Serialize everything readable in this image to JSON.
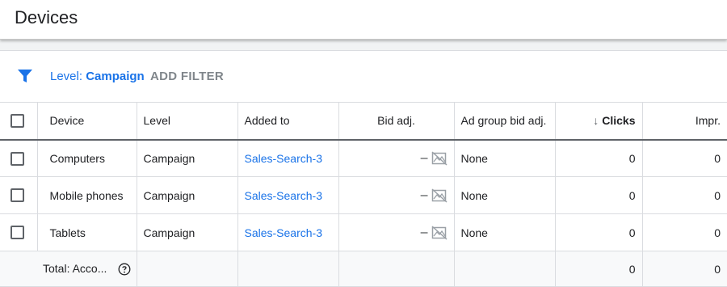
{
  "page": {
    "title": "Devices"
  },
  "filter": {
    "level_prefix": "Level: ",
    "level_value": "Campaign",
    "add_filter_label": "ADD FILTER"
  },
  "table": {
    "columns": {
      "device": "Device",
      "level": "Level",
      "added_to": "Added to",
      "bid_adj": "Bid adj.",
      "ad_group_bid_adj": "Ad group bid adj.",
      "clicks": "Clicks",
      "impr": "Impr."
    },
    "rows": [
      {
        "device": "Computers",
        "level": "Campaign",
        "added_to": "Sales-Search-3",
        "bid_adj": "–",
        "ad_group_bid_adj": "None",
        "clicks": "0",
        "impr": "0"
      },
      {
        "device": "Mobile phones",
        "level": "Campaign",
        "added_to": "Sales-Search-3",
        "bid_adj": "–",
        "ad_group_bid_adj": "None",
        "clicks": "0",
        "impr": "0"
      },
      {
        "device": "Tablets",
        "level": "Campaign",
        "added_to": "Sales-Search-3",
        "bid_adj": "–",
        "ad_group_bid_adj": "None",
        "clicks": "0",
        "impr": "0"
      }
    ],
    "total": {
      "label": "Total: Acco...",
      "clicks": "0",
      "impr": "0"
    }
  },
  "colors": {
    "accent": "#1a73e8",
    "muted": "#80868b",
    "border": "#dadce0"
  }
}
